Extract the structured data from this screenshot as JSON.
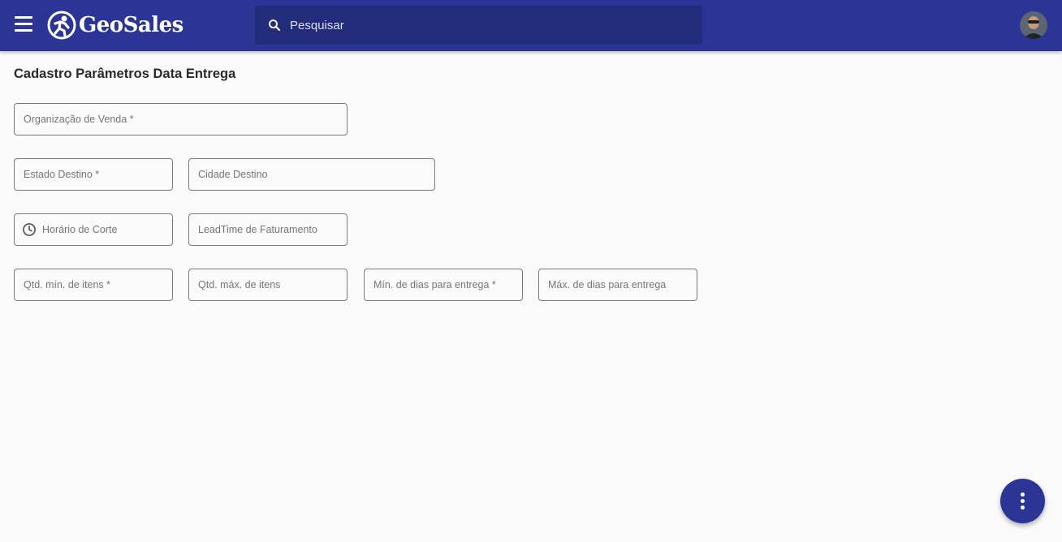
{
  "app": {
    "brand": "GeoSales"
  },
  "header": {
    "menu_icon": "hamburger-menu-icon",
    "search": {
      "placeholder": "Pesquisar",
      "value": ""
    },
    "colors": {
      "primary": "#2b3595",
      "search_bg": "#222c7a"
    }
  },
  "page": {
    "title": "Cadastro Parâmetros Data Entrega"
  },
  "form": {
    "organizacao_venda": {
      "placeholder": "Organização de Venda *",
      "value": ""
    },
    "estado_destino": {
      "placeholder": "Estado Destino *",
      "value": ""
    },
    "cidade_destino": {
      "placeholder": "Cidade Destino",
      "value": ""
    },
    "horario_corte": {
      "placeholder": "Horário de Corte",
      "value": "",
      "icon": "clock-icon"
    },
    "leadtime_faturamento": {
      "placeholder": "LeadTime de Faturamento",
      "value": ""
    },
    "qtd_min_itens": {
      "placeholder": "Qtd. mín. de itens *",
      "value": ""
    },
    "qtd_max_itens": {
      "placeholder": "Qtd. máx. de itens",
      "value": ""
    },
    "min_dias_entrega": {
      "placeholder": "Mín. de dias para entrega *",
      "value": ""
    },
    "max_dias_entrega": {
      "placeholder": "Máx. de dias para entrega",
      "value": ""
    }
  },
  "fab": {
    "icon": "more-vertical-icon"
  }
}
